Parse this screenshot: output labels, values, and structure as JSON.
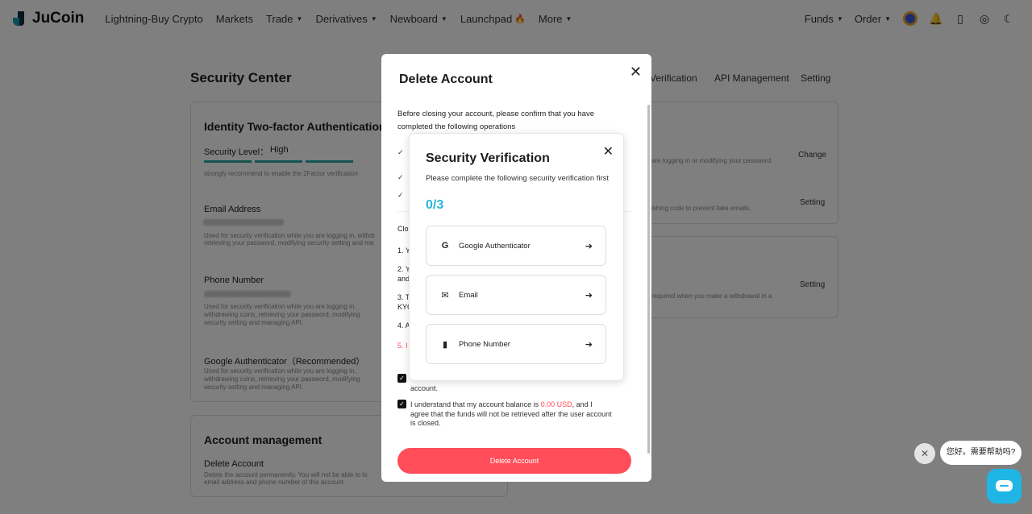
{
  "nav": {
    "logo": "JuCoin",
    "items": [
      {
        "label": "Lightning-Buy Crypto",
        "caret": false
      },
      {
        "label": "Markets",
        "caret": false
      },
      {
        "label": "Trade",
        "caret": true
      },
      {
        "label": "Derivatives",
        "caret": true
      },
      {
        "label": "Newboard",
        "caret": true
      },
      {
        "label": "Launchpad",
        "caret": false
      },
      {
        "label": "More",
        "caret": true
      }
    ],
    "right": {
      "funds": "Funds",
      "order": "Order"
    }
  },
  "page": {
    "title": "Security Center",
    "subnav": [
      "Verification",
      "API Management",
      "Setting"
    ],
    "identity": {
      "title": "Identity Two-factor Authentication",
      "level_label": "Security Level：",
      "level_value": "High",
      "hint": "strongly recommend to enable the 2Factor verification"
    },
    "email": {
      "label": "Email Address",
      "desc": "Used for security verification while you are logging in, withdr",
      "desc2": "retrieving your password, modifying security setting and ma"
    },
    "phone": {
      "label": "Phone Number",
      "desc": "Used for security verification while you are logging in, withdrawing coins, retrieving your password, modifying security setting and managing API."
    },
    "google": {
      "label": "Google Authenticator（Recommended）",
      "desc": "Used for security verification while you are logging in, withdrawing coins, retrieving your password, modifying security setting and managing API."
    },
    "right_rows": [
      {
        "desc": "are logging in or modifying your password.",
        "action": "Change"
      },
      {
        "desc": "ishing code to prevent fake emails.",
        "action": "Setting"
      },
      {
        "desc": "required when you make a withdrawal in a",
        "action": "Setting"
      }
    ],
    "account": {
      "title": "Account management",
      "delete_label": "Delete Account",
      "delete_desc": "Delete the account permanently.  You will not be able to lo",
      "delete_desc2": "email address and phone number of this account."
    }
  },
  "modal": {
    "title": "Delete Account",
    "intro": "Before closing your account, please confirm that you have completed the following operations",
    "section_prefix": "Clo",
    "items": [
      "1. Y",
      "2. Y",
      "and",
      "3. T",
      "KYC",
      "4. A"
    ],
    "red_item": "5. I",
    "check1_tail": "account.",
    "check2_a": "I understand that my account balance is ",
    "check2_amount": "0.00 USD",
    "check2_b": ", and I agree that the funds will not be retrieved after the user account is closed.",
    "button": "Delete Account"
  },
  "verification": {
    "title": "Security Verification",
    "desc": "Please complete the following security verification first",
    "progress": "0/3",
    "options": [
      {
        "icon": "google-icon",
        "label": "Google Authenticator"
      },
      {
        "icon": "mail-icon",
        "label": "Email"
      },
      {
        "icon": "phone-icon",
        "label": "Phone Number"
      }
    ]
  },
  "chat": {
    "bubble": "您好。需要帮助吗?"
  },
  "colors": {
    "accent": "#29b6d8",
    "danger": "#ff4d5a",
    "level": "#2aa9a0"
  }
}
